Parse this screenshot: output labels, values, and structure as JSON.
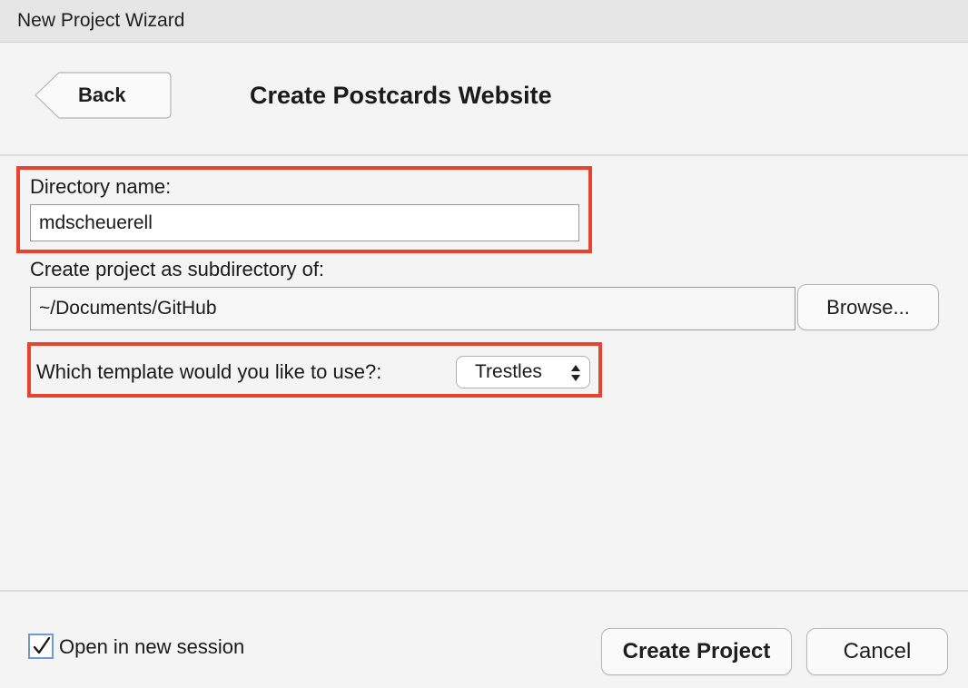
{
  "window": {
    "title": "New Project Wizard"
  },
  "header": {
    "back_label": "Back",
    "title": "Create Postcards Website"
  },
  "form": {
    "directory_name_label": "Directory name:",
    "directory_name_value": "mdscheuerell",
    "subdirectory_label": "Create project as subdirectory of:",
    "subdirectory_value": "~/Documents/GitHub",
    "browse_label": "Browse...",
    "template_label": "Which template would you like to use?:",
    "template_selected": "Trestles"
  },
  "footer": {
    "open_new_session_label": "Open in new session",
    "open_new_session_checked": true,
    "create_project_label": "Create Project",
    "cancel_label": "Cancel"
  },
  "colors": {
    "highlight": "#e8432e",
    "checkbox_border": "#6f9ad6",
    "background": "#f4f4f4"
  }
}
